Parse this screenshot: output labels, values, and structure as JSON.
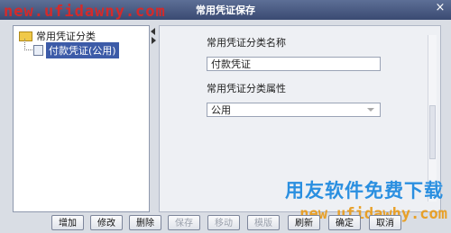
{
  "window": {
    "title": "常用凭证保存"
  },
  "watermark": {
    "top_url": "new.ufidawny.com",
    "brand": "用友软件免费下载",
    "bottom_url": "new.ufidawhy.com"
  },
  "tree": {
    "root_label": "常用凭证分类",
    "child_label": "付款凭证(公用)"
  },
  "form": {
    "name_label": "常用凭证分类名称",
    "name_value": "付款凭证",
    "attr_label": "常用凭证分类属性",
    "attr_value": "公用"
  },
  "buttons": [
    "增加",
    "修改",
    "删除",
    "保存",
    "移动",
    "模版",
    "刷新",
    "确定",
    "取消"
  ]
}
